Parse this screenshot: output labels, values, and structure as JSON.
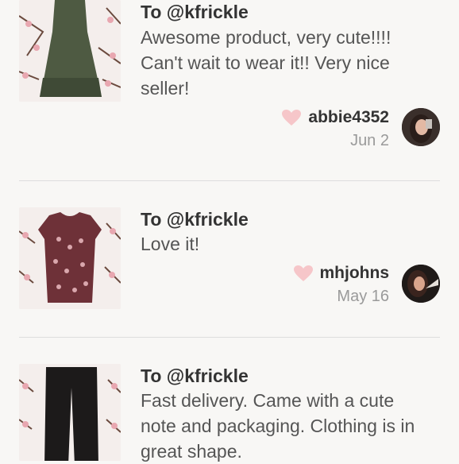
{
  "reviews": [
    {
      "to": "To @kfrickle",
      "message": "Awesome product, very cute!!!! Can't wait to wear it!! Very nice seller!",
      "username": "abbie4352",
      "date": "Jun 2",
      "item_icon": "green-dress-photo",
      "avatar_icon": "user-avatar-photo"
    },
    {
      "to": "To @kfrickle",
      "message": "Love it!",
      "username": "mhjohns",
      "date": "May 16",
      "item_icon": "floral-top-photo",
      "avatar_icon": "user-avatar-photo"
    },
    {
      "to": "To @kfrickle",
      "message": "Fast delivery. Came with a cute note and packaging. Clothing is in great shape.",
      "item_icon": "black-pants-photo"
    }
  ],
  "colors": {
    "background": "#f8f7f5",
    "heart": "#f6c6c9",
    "date": "#9a9a9a",
    "divider": "#dddddd"
  }
}
